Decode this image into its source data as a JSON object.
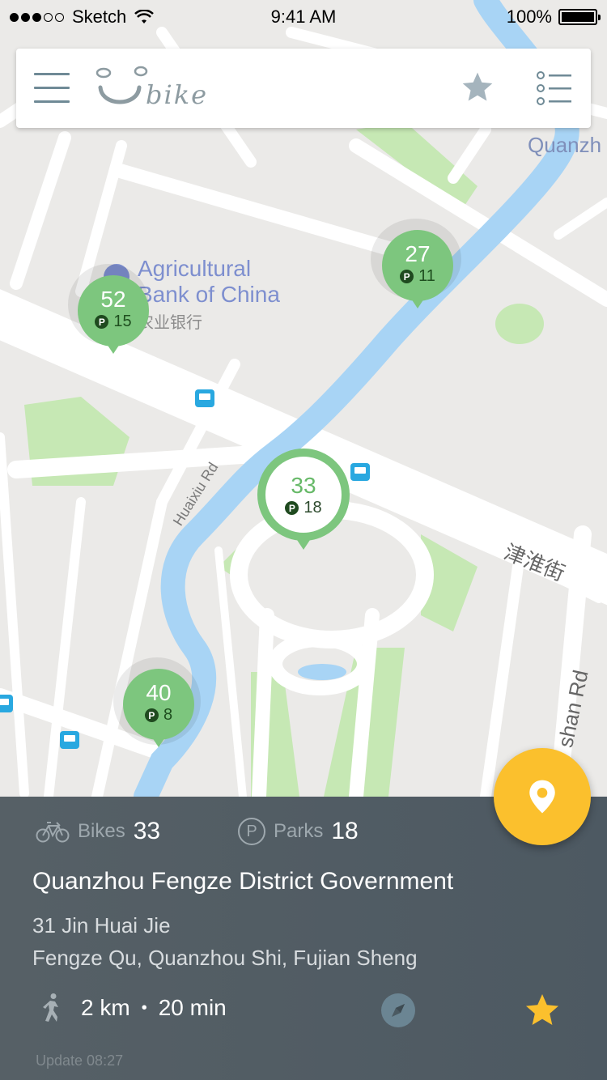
{
  "status_bar": {
    "carrier": "Sketch",
    "time": "9:41 AM",
    "battery": "100%",
    "signal_bars_filled": 3,
    "signal_bars_total": 5
  },
  "top_bar": {
    "logo_text": "bike",
    "menu_icon": "hamburger-icon",
    "favorites_icon": "star-icon",
    "list_icon": "list-icon"
  },
  "map": {
    "labels": {
      "poi_en_1": "Agricultural",
      "poi_en_2": "Bank of China",
      "poi_cn": "农业银行",
      "district": "Quanzh",
      "road_huaixiu": "Huaixiu Rd",
      "road_jinhuai": "津淮街",
      "road_shan": "shan Rd"
    },
    "stations": [
      {
        "id": "s52",
        "bikes": "52",
        "parks": "15",
        "selected": false
      },
      {
        "id": "s27",
        "bikes": "27",
        "parks": "11",
        "selected": false
      },
      {
        "id": "s33",
        "bikes": "33",
        "parks": "18",
        "selected": true
      },
      {
        "id": "s40",
        "bikes": "40",
        "parks": "8",
        "selected": false
      }
    ],
    "park_badge": "P"
  },
  "panel": {
    "bikes_label": "Bikes",
    "bikes_value": "33",
    "parks_label": "Parks",
    "parks_value": "18",
    "parks_icon_letter": "P",
    "station_name": "Quanzhou Fengze District Government",
    "address_line1": "31 Jin Huai Jie",
    "address_line2": "Fengze Qu, Quanzhou Shi, Fujian Sheng",
    "distance": "2 km",
    "separator": "•",
    "duration": "20 min",
    "update": "Update 08:27"
  },
  "colors": {
    "marker_green": "#7dc67e",
    "fab_yellow": "#fbc02d",
    "panel_bg": "#525d63",
    "water": "#a8d4f5",
    "park": "#c6e8b4"
  }
}
